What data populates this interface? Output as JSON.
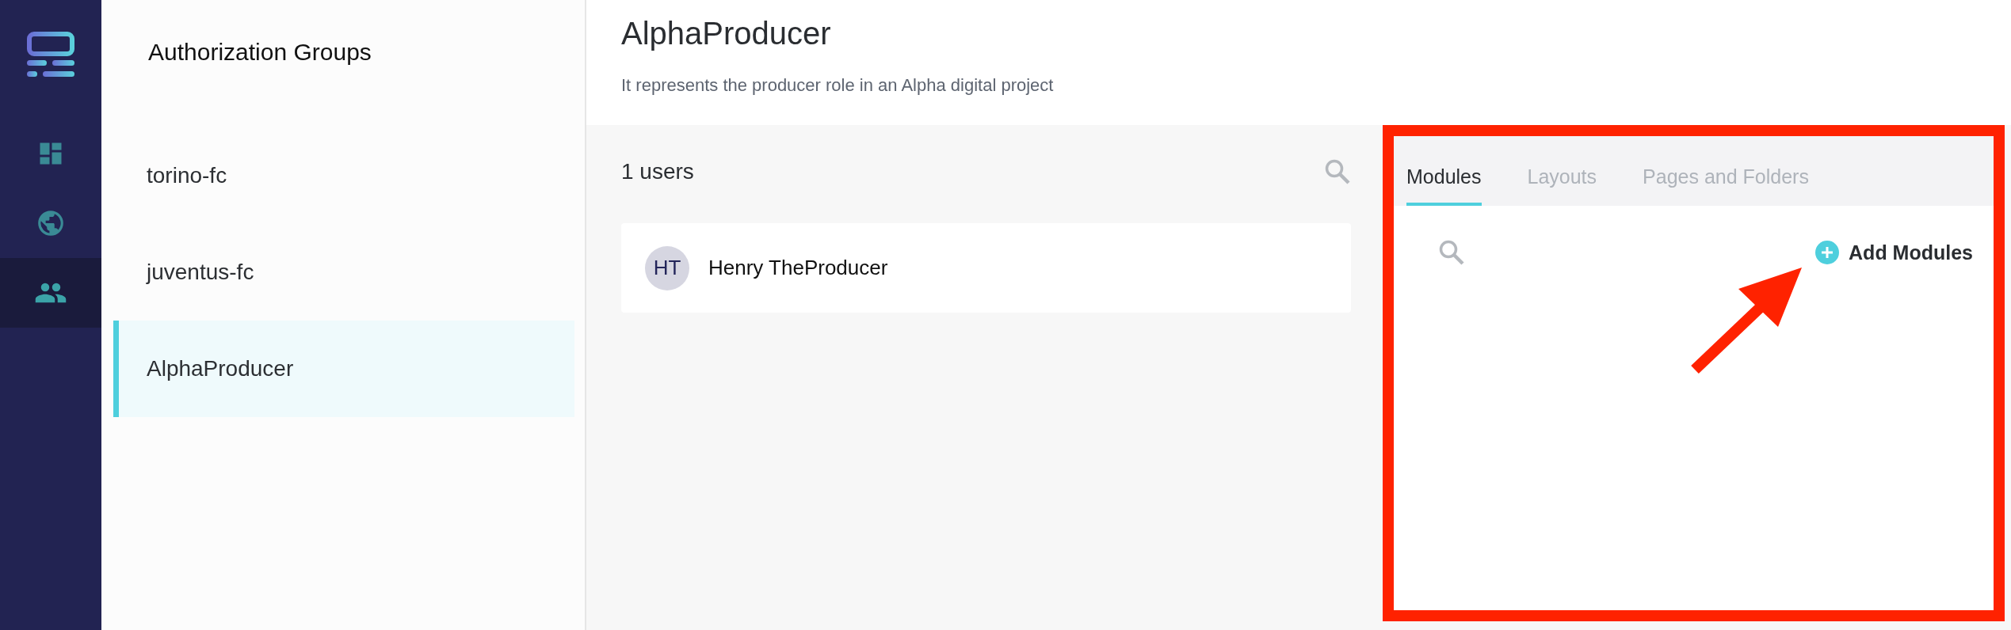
{
  "nav": {
    "items": [
      {
        "kind": "dashboard",
        "selected": false
      },
      {
        "kind": "globe",
        "selected": false
      },
      {
        "kind": "people",
        "selected": true
      }
    ]
  },
  "groups": {
    "title": "Authorization Groups",
    "items": [
      {
        "label": "torino-fc",
        "selected": false
      },
      {
        "label": "juventus-fc",
        "selected": false
      },
      {
        "label": "AlphaProducer",
        "selected": true
      }
    ]
  },
  "detail": {
    "title": "AlphaProducer",
    "description": "It represents the producer role in an Alpha digital project",
    "users": {
      "count": "1 users",
      "items": [
        {
          "initials": "HT",
          "name": "Henry TheProducer"
        }
      ]
    },
    "tabs": [
      {
        "label": "Modules",
        "selected": true
      },
      {
        "label": "Layouts",
        "selected": false
      },
      {
        "label": "Pages and Folders",
        "selected": false
      }
    ],
    "add_button": "Add Modules"
  },
  "annotations": {
    "highlight_box": true,
    "pointer_arrow": true
  }
}
